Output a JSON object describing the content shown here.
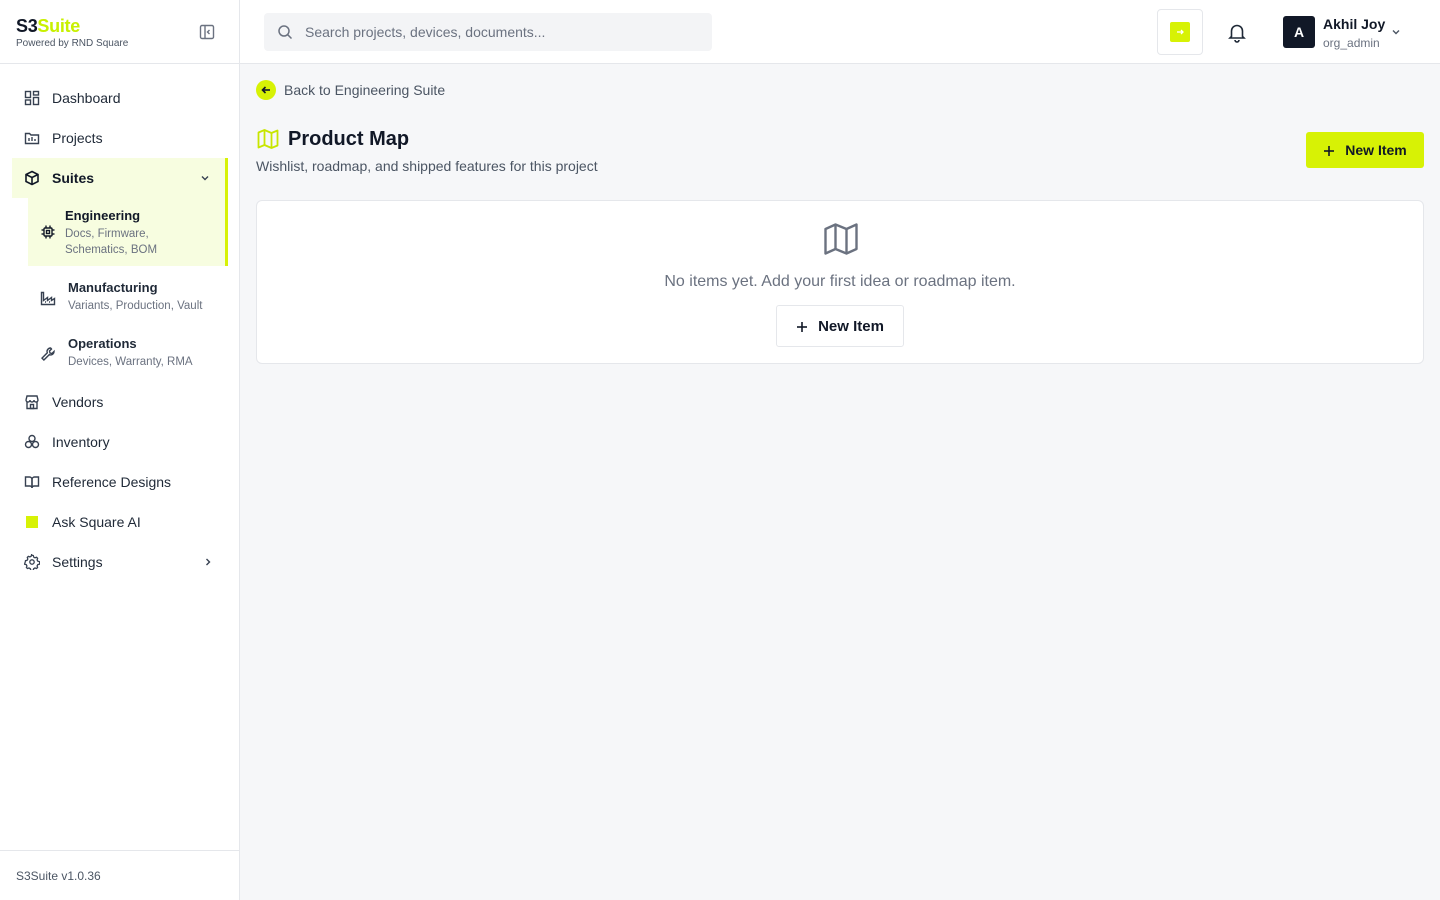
{
  "brand": {
    "name_part1": "S3",
    "name_part2": "Suite",
    "tagline": "Powered by RND Square",
    "version": "S3Suite v1.0.36"
  },
  "sidebar": {
    "items": [
      {
        "label": "Dashboard",
        "icon": "dashboard-icon"
      },
      {
        "label": "Projects",
        "icon": "projects-icon"
      },
      {
        "label": "Suites",
        "icon": "box-icon"
      },
      {
        "label": "Vendors",
        "icon": "store-icon"
      },
      {
        "label": "Inventory",
        "icon": "inventory-icon"
      },
      {
        "label": "Reference Designs",
        "icon": "book-icon"
      },
      {
        "label": "Ask Square AI",
        "icon": "ai-square-icon"
      },
      {
        "label": "Settings",
        "icon": "gear-icon"
      }
    ],
    "suites": [
      {
        "title": "Engineering",
        "desc_line1": "Docs, Firmware,",
        "desc_line2": "Schematics, BOM",
        "icon": "chip-icon"
      },
      {
        "title": "Manufacturing",
        "desc_line1": "Variants, Production, Vault",
        "icon": "factory-icon"
      },
      {
        "title": "Operations",
        "desc_line1": "Devices, Warranty, RMA",
        "icon": "wrench-icon"
      }
    ]
  },
  "search": {
    "placeholder": "Search projects, devices, documents...",
    "value": ""
  },
  "user": {
    "initial": "A",
    "name": "Akhil Joy",
    "role": "org_admin"
  },
  "page": {
    "back_label": "Back to Engineering Suite",
    "title": "Product Map",
    "subtitle": "Wishlist, roadmap, and shipped features for this project",
    "new_item_label": "New Item",
    "empty_text": "No items yet. Add your first idea or roadmap item.",
    "empty_button_label": "New Item"
  },
  "colors": {
    "accent": "#d7f205",
    "accent_soft": "#f7fde0",
    "dark": "#111827"
  }
}
